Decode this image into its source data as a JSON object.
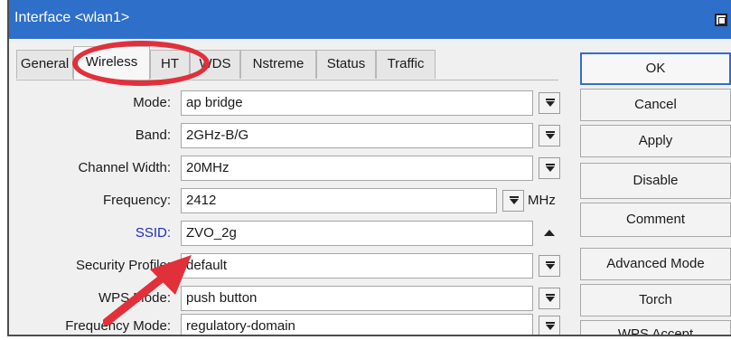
{
  "window": {
    "title": "Interface <wlan1>"
  },
  "tabs": [
    {
      "label": "General",
      "active": false
    },
    {
      "label": "Wireless",
      "active": true
    },
    {
      "label": "HT",
      "active": false
    },
    {
      "label": "WDS",
      "active": false
    },
    {
      "label": "Nstreme",
      "active": false
    },
    {
      "label": "Status",
      "active": false
    },
    {
      "label": "Traffic",
      "active": false
    }
  ],
  "fields": {
    "mode": {
      "label": "Mode:",
      "value": "ap bridge"
    },
    "band": {
      "label": "Band:",
      "value": "2GHz-B/G"
    },
    "channel_width": {
      "label": "Channel Width:",
      "value": "20MHz"
    },
    "frequency": {
      "label": "Frequency:",
      "value": "2412",
      "unit": "MHz"
    },
    "ssid": {
      "label": "SSID:",
      "value": "ZVO_2g"
    },
    "security_profile": {
      "label": "Security Profile:",
      "value": "default"
    },
    "wps_mode": {
      "label": "WPS Mode:",
      "value": "push button"
    },
    "frequency_mode": {
      "label": "Frequency Mode:",
      "value": "regulatory-domain"
    }
  },
  "buttons": {
    "ok": "OK",
    "cancel": "Cancel",
    "apply": "Apply",
    "disable": "Disable",
    "comment": "Comment",
    "advanced_mode": "Advanced Mode",
    "torch": "Torch",
    "wps_accept": "WPS Accept"
  },
  "colors": {
    "titlebar": "#2e6fc9",
    "ssid_label": "#1c2fbf",
    "annotation": "#e1303a"
  },
  "icons": [
    "dropdown-arrow-icon",
    "collapse-up-icon",
    "maximize-icon",
    "annotation-arrow-icon"
  ]
}
